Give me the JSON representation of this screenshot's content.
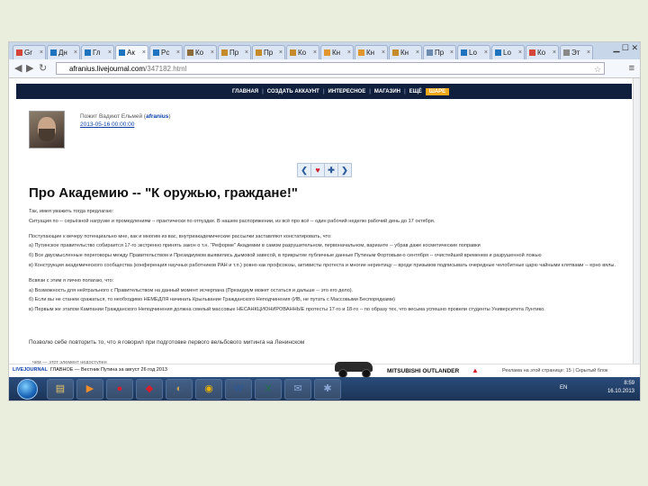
{
  "browser": {
    "tabs": [
      {
        "label": "Gr",
        "icon_color": "#d44638",
        "active": false
      },
      {
        "label": "Дн",
        "icon_color": "#1e73be",
        "active": false
      },
      {
        "label": "Гл",
        "icon_color": "#1e73be",
        "active": false
      },
      {
        "label": "Ак",
        "icon_color": "#1e73be",
        "active": true
      },
      {
        "label": "Рс",
        "icon_color": "#1e73be",
        "active": false
      },
      {
        "label": "Ко",
        "icon_color": "#8e6b3a",
        "active": false
      },
      {
        "label": "Пр",
        "icon_color": "#c48a2c",
        "active": false
      },
      {
        "label": "Пр",
        "icon_color": "#c48a2c",
        "active": false
      },
      {
        "label": "Ко",
        "icon_color": "#c48a2c",
        "active": false
      },
      {
        "label": "Кн",
        "icon_color": "#e0962c",
        "active": false
      },
      {
        "label": "Кн",
        "icon_color": "#e0962c",
        "active": false
      },
      {
        "label": "Кн",
        "icon_color": "#c48a2c",
        "active": false
      },
      {
        "label": "Пр",
        "icon_color": "#6c8bb0",
        "active": false
      },
      {
        "label": "Lo",
        "icon_color": "#1e73be",
        "active": false
      },
      {
        "label": "Lo",
        "icon_color": "#1e73be",
        "active": false
      },
      {
        "label": "Ко",
        "icon_color": "#d44638",
        "active": false
      },
      {
        "label": "Эт",
        "icon_color": "#888888",
        "active": false
      }
    ],
    "url_host": "afranius.livejournal.com",
    "url_path": "/347182.html"
  },
  "site": {
    "nav": [
      "ГЛАВНАЯ",
      "СОЗДАТЬ АККАУНТ",
      "ИНТЕРЕСНОЕ",
      "МАГАЗИН",
      "ЕЩЁ"
    ],
    "nav_highlight": "ШАРЕ"
  },
  "post": {
    "author_line": "Пожит Вадиют Ельмей (",
    "username": "afranius",
    "author_tail": ")",
    "date": "2013-05-16 00:00:00",
    "title": "Про Академию -- \"К оружью, граждане!\"",
    "paragraphs": [
      "Так, имея уважить тогда предлагаю:",
      "Ситуация по -- серьёзной нагрузке и промедлениям -- практически по отпуздке. В нашем распоряжении, из всё про всё -- один рабочий неделю рабочий день до 17 октября.",
      "",
      "Поступающие к вечеру потенциально мне, как и многим из вас, внутриакадемические рассылки заставляют констатировать, что:",
      "а) Путинское правительство собирается 17-го экстренно принять закон о т.н. \"Реформе\" Академии в самом разрушительном, первоначальном, варианте -- убрав даже косметические поправки",
      "б) Все двусмысленные переговоры между Правительством и Президиумом выявились дымовой завесой, в прикрытие публичные данные Путиным Фортовым-о сентября -- очистейшей временем и разрушенной ложью",
      "в) Конструкция академического сообщества (конференция научных работников РАН и т.п.) ровно как профсоюзы, активисты протеста и многие неринтицу -- вроде призывов подписывать очередные челобитные царю чайными клятвами -- ерно вялы.",
      "",
      "Всвязи с этим я лично полагаю, что:",
      "а) Возможность для нейтрального с Правительством на данный момент исчерпана (Президиум может остаться и дальше -- это его дело).",
      "б) Если вы не станем сражаться, то необходимо НЕМЕДЛЯ начинать Крыльвание Гражданского Неподчинения (ИВ, не путать с Массовыми Беспорядками)",
      "в) Первым же этапом Кампании Гражданского Неподчинения должна смелый массовые НЕСАНКЦИОНИРОВАННЫЕ протесты 17-го и 18-го -- по образу тех, что весьма успешно провели студенты Университета Лунтико."
    ],
    "closing": "Позволю себе повторить то, что я говорил при подготовке первого вельбового митинга на Ленинском"
  },
  "statusbar": {
    "prefix": "LIVEJOURNAL",
    "text": "ГЛАВНОЕ — Вестник Путина за август 26 год 2013"
  },
  "ljlink": "чем — этот элемент недоступен",
  "ad": {
    "brand": "MITSUBISHI OUTLANDER",
    "right_text": "Реклама на этой странице: 15   |   Скрытый блок"
  },
  "taskbar": {
    "apps": [
      {
        "icon": "explorer-icon",
        "glyph": "▤",
        "color": "#e9c46a"
      },
      {
        "icon": "media-icon",
        "glyph": "▶",
        "color": "#f28c28"
      },
      {
        "icon": "opera-icon",
        "glyph": "●",
        "color": "#d31f2d"
      },
      {
        "icon": "pdf-icon",
        "glyph": "◆",
        "color": "#d31f2d"
      },
      {
        "icon": "photo-icon",
        "glyph": "◐",
        "color": "#c0a060"
      },
      {
        "icon": "chrome-icon",
        "glyph": "◉",
        "color": "#e8b100"
      },
      {
        "icon": "word-icon",
        "glyph": "W",
        "color": "#2b579a"
      },
      {
        "icon": "excel-icon",
        "glyph": "X",
        "color": "#217346"
      },
      {
        "icon": "messenger-icon",
        "glyph": "✉",
        "color": "#8aa6d4"
      },
      {
        "icon": "tools-icon",
        "glyph": "✱",
        "color": "#8aa6d4"
      }
    ],
    "lang": "EN",
    "time": "8:59",
    "date": "16.10.2013"
  }
}
